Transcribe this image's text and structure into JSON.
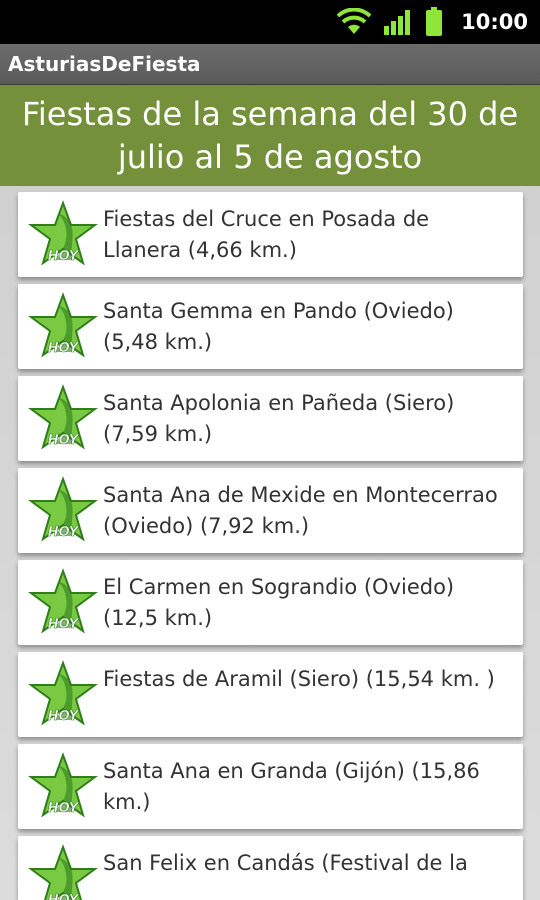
{
  "status_bar": {
    "time": "10:00",
    "icons": [
      "wifi-icon",
      "signal-icon",
      "battery-icon"
    ]
  },
  "app": {
    "title": "AsturiasDeFiesta"
  },
  "header": {
    "title": "Fiestas de la semana del 30 de julio al 5 de agosto"
  },
  "badge_label": "HOY",
  "colors": {
    "header_bg": "#74903a",
    "badge_green": "#7ac943",
    "badge_dark": "#2f7d1b"
  },
  "items": [
    {
      "text": "Fiestas del Cruce en Posada de Llanera (4,66 km.)"
    },
    {
      "text": "Santa Gemma en Pando (Oviedo) (5,48 km.)"
    },
    {
      "text": "Santa Apolonia en Pañeda (Siero) (7,59 km.)"
    },
    {
      "text": "Santa Ana de Mexide en Montecerrao (Oviedo) (7,92 km.)"
    },
    {
      "text": "El Carmen en Sograndio (Oviedo) (12,5 km.)"
    },
    {
      "text": "Fiestas de Aramil (Siero) (15,54 km. )"
    },
    {
      "text": "Santa Ana en Granda (Gijón) (15,86 km.)"
    },
    {
      "text": "San Felix en Candás (Festival de la"
    }
  ]
}
